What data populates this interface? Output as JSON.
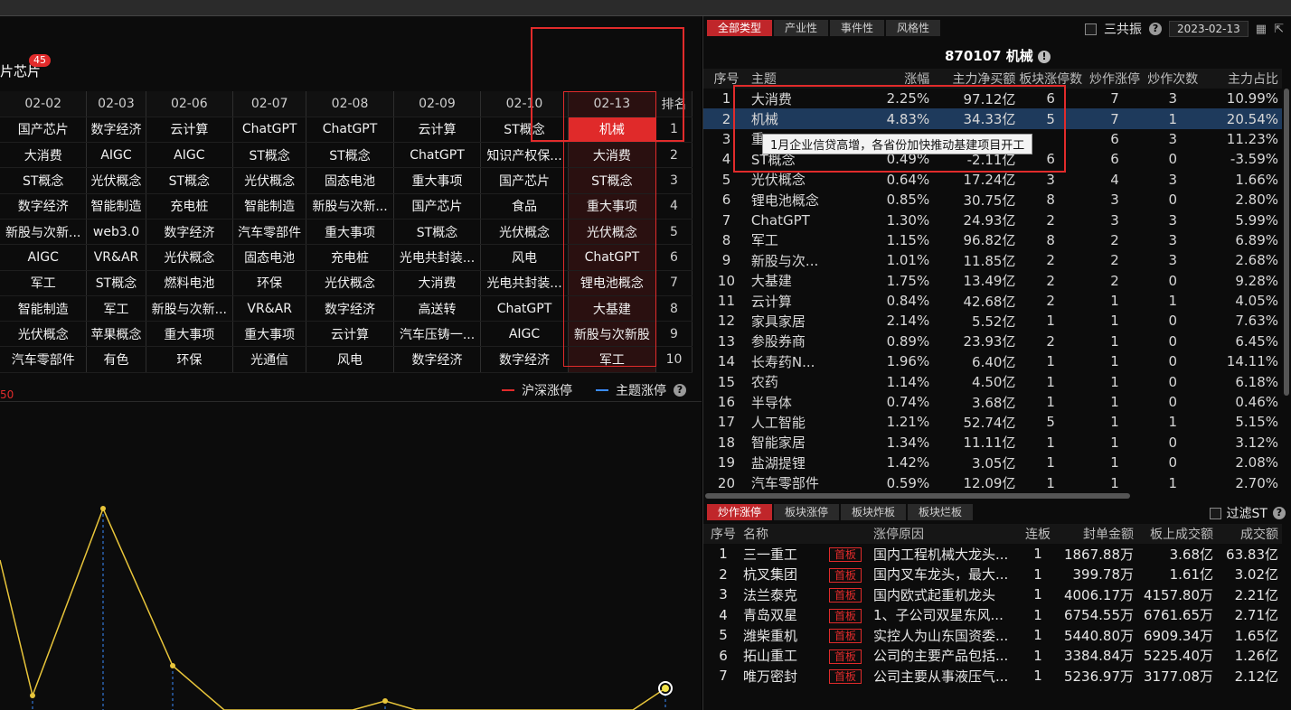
{
  "left": {
    "title": "片芯片",
    "badge": "45",
    "dates": [
      "02-02",
      "02-03",
      "02-06",
      "02-07",
      "02-08",
      "02-09",
      "02-10",
      "02-13"
    ],
    "rank_header": "排名",
    "rows": [
      [
        "国产芯片",
        "数字经济",
        "云计算",
        "ChatGPT",
        "ChatGPT",
        "云计算",
        "ST概念",
        "机械",
        "1"
      ],
      [
        "大消费",
        "AIGC",
        "AIGC",
        "ST概念",
        "ST概念",
        "ChatGPT",
        "知识产权保...",
        "大消费",
        "2"
      ],
      [
        "ST概念",
        "光伏概念",
        "ST概念",
        "光伏概念",
        "固态电池",
        "重大事项",
        "国产芯片",
        "ST概念",
        "3"
      ],
      [
        "数字经济",
        "智能制造",
        "充电桩",
        "智能制造",
        "新股与次新...",
        "国产芯片",
        "食品",
        "重大事项",
        "4"
      ],
      [
        "新股与次新...",
        "web3.0",
        "数字经济",
        "汽车零部件",
        "重大事项",
        "ST概念",
        "光伏概念",
        "光伏概念",
        "5"
      ],
      [
        "AIGC",
        "VR&AR",
        "光伏概念",
        "固态电池",
        "充电桩",
        "光电共封装...",
        "风电",
        "ChatGPT",
        "6"
      ],
      [
        "军工",
        "ST概念",
        "燃料电池",
        "环保",
        "光伏概念",
        "大消费",
        "光电共封装...",
        "锂电池概念",
        "7"
      ],
      [
        "智能制造",
        "军工",
        "新股与次新...",
        "VR&AR",
        "数字经济",
        "高送转",
        "ChatGPT",
        "大基建",
        "8"
      ],
      [
        "光伏概念",
        "苹果概念",
        "重大事项",
        "重大事项",
        "云计算",
        "汽车压铸一...",
        "AIGC",
        "新股与次新股",
        "9"
      ],
      [
        "汽车零部件",
        "有色",
        "环保",
        "光通信",
        "风电",
        "数字经济",
        "数字经济",
        "军工",
        "10"
      ]
    ],
    "legend": {
      "a": "沪深涨停",
      "b": "主题涨停"
    },
    "ytick": "50",
    "colors": {
      "accent": "#e12b2b",
      "line": "#e8c53a",
      "blue": "#3a8cff"
    }
  },
  "right": {
    "tabs": [
      "全部类型",
      "产业性",
      "事件性",
      "风格性"
    ],
    "sanggongzhen": "三共振",
    "date": "2023-02-13",
    "sector_title": "870107 机械",
    "headers": [
      "序号",
      "主题",
      "涨幅",
      "主力净买额",
      "板块涨停数",
      "炒作涨停",
      "炒作次数",
      "主力占比"
    ],
    "rows": [
      [
        "1",
        "大消费",
        "2.25%",
        "97.12亿",
        "6",
        "7",
        "3",
        "10.99%"
      ],
      [
        "2",
        "机械",
        "4.83%",
        "34.33亿",
        "5",
        "7",
        "1",
        "20.54%"
      ],
      [
        "3",
        "重",
        "",
        "",
        "",
        "6",
        "3",
        "11.23%"
      ],
      [
        "4",
        "ST概念",
        "0.49%",
        "-2.11亿",
        "6",
        "6",
        "0",
        "-3.59%"
      ],
      [
        "5",
        "光伏概念",
        "0.64%",
        "17.24亿",
        "3",
        "4",
        "3",
        "1.66%"
      ],
      [
        "6",
        "锂电池概念",
        "0.85%",
        "30.75亿",
        "8",
        "3",
        "0",
        "2.80%"
      ],
      [
        "7",
        "ChatGPT",
        "1.30%",
        "24.93亿",
        "2",
        "3",
        "3",
        "5.99%"
      ],
      [
        "8",
        "军工",
        "1.15%",
        "96.82亿",
        "8",
        "2",
        "3",
        "6.89%"
      ],
      [
        "9",
        "新股与次...",
        "1.01%",
        "11.85亿",
        "2",
        "2",
        "3",
        "2.68%"
      ],
      [
        "10",
        "大基建",
        "1.75%",
        "13.49亿",
        "2",
        "2",
        "0",
        "9.28%"
      ],
      [
        "11",
        "云计算",
        "0.84%",
        "42.68亿",
        "2",
        "1",
        "1",
        "4.05%"
      ],
      [
        "12",
        "家具家居",
        "2.14%",
        "5.52亿",
        "1",
        "1",
        "0",
        "7.63%"
      ],
      [
        "13",
        "参股券商",
        "0.89%",
        "23.93亿",
        "2",
        "1",
        "0",
        "6.45%"
      ],
      [
        "14",
        "长寿药N...",
        "1.96%",
        "6.40亿",
        "1",
        "1",
        "0",
        "14.11%"
      ],
      [
        "15",
        "农药",
        "1.14%",
        "4.50亿",
        "1",
        "1",
        "0",
        "6.18%"
      ],
      [
        "16",
        "半导体",
        "0.74%",
        "3.68亿",
        "1",
        "1",
        "0",
        "0.46%"
      ],
      [
        "17",
        "人工智能",
        "1.21%",
        "52.74亿",
        "5",
        "1",
        "1",
        "5.15%"
      ],
      [
        "18",
        "智能家居",
        "1.34%",
        "11.11亿",
        "1",
        "1",
        "0",
        "3.12%"
      ],
      [
        "19",
        "盐湖提锂",
        "1.42%",
        "3.05亿",
        "1",
        "1",
        "0",
        "2.08%"
      ],
      [
        "20",
        "汽车零部件",
        "0.59%",
        "12.09亿",
        "1",
        "1",
        "1",
        "2.70%"
      ]
    ],
    "name_colors": [
      "white",
      "white",
      "white",
      "white",
      "blue",
      "blue",
      "white",
      "blue",
      "white",
      "white",
      "white",
      "white",
      "white",
      "white",
      "white",
      "white",
      "white",
      "white",
      "white",
      "blue"
    ],
    "tooltip": "1月企业信贷高增，各省份加快推动基建项目开工",
    "tabs2": [
      "炒作涨停",
      "板块涨停",
      "板块炸板",
      "板块烂板"
    ],
    "filter_label": "过滤ST",
    "bheaders": [
      "序号",
      "名称",
      "",
      "涨停原因",
      "连板",
      "封单金额",
      "板上成交额",
      "成交额"
    ],
    "brows": [
      [
        "1",
        "三一重工",
        "首板",
        "国内工程机械大龙头...",
        "1",
        "1867.88万",
        "3.68亿",
        "63.83亿"
      ],
      [
        "2",
        "杭叉集团",
        "首板",
        "国内叉车龙头，最大...",
        "1",
        "399.78万",
        "1.61亿",
        "3.02亿"
      ],
      [
        "3",
        "法兰泰克",
        "首板",
        "国内欧式起重机龙头",
        "1",
        "4006.17万",
        "4157.80万",
        "2.21亿"
      ],
      [
        "4",
        "青岛双星",
        "首板",
        "1、子公司双星东风...",
        "1",
        "6754.55万",
        "6761.65万",
        "2.71亿"
      ],
      [
        "5",
        "潍柴重机",
        "首板",
        "实控人为山东国资委...",
        "1",
        "5440.80万",
        "6909.34万",
        "1.65亿"
      ],
      [
        "6",
        "拓山重工",
        "首板",
        "公司的主要产品包括...",
        "1",
        "3384.84万",
        "5225.40万",
        "1.26亿"
      ],
      [
        "7",
        "唯万密封",
        "首板",
        "公司主要从事液压气...",
        "1",
        "5236.97万",
        "3177.08万",
        "2.12亿"
      ]
    ]
  }
}
